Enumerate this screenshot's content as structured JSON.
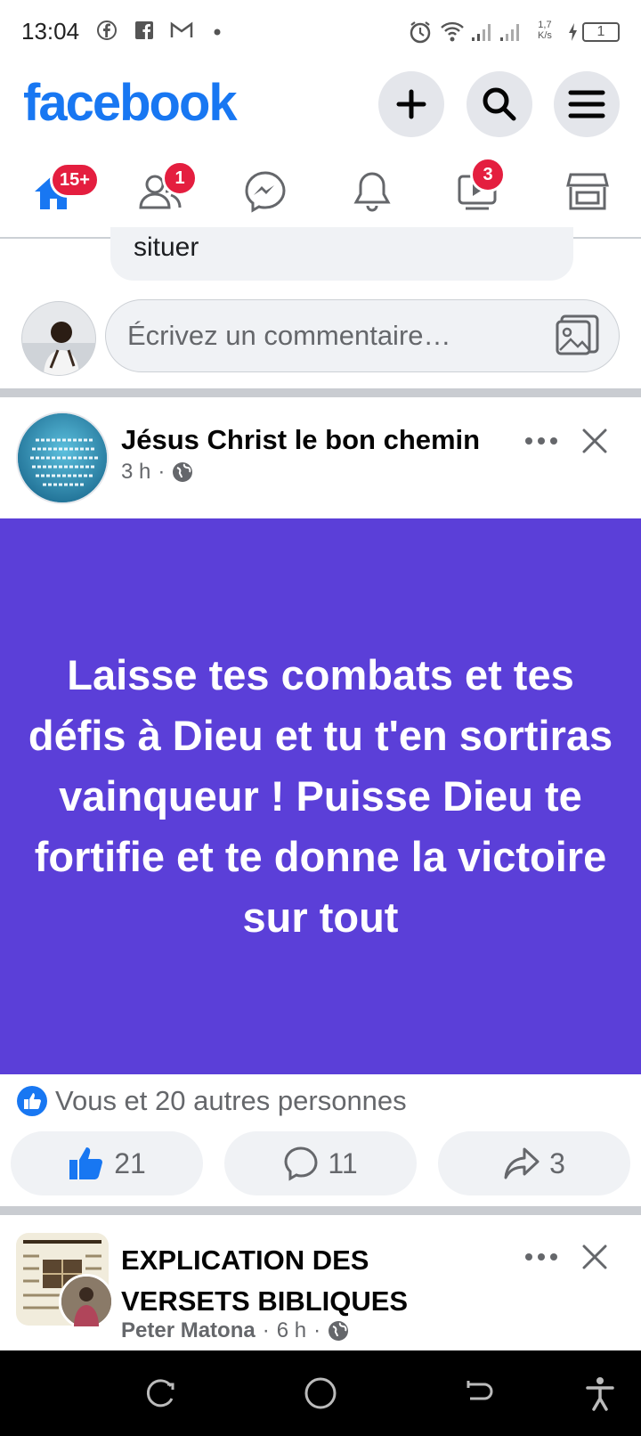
{
  "status_bar": {
    "time": "13:04",
    "network_speed_top": "1,7",
    "network_speed_bottom": "K/s",
    "battery": "1"
  },
  "header": {
    "brand": "facebook",
    "icons": [
      "plus-icon",
      "search-icon",
      "menu-icon"
    ]
  },
  "nav": {
    "home_badge": "15+",
    "friends_badge": "1",
    "video_badge": "3",
    "icons": [
      "home-icon",
      "friends-icon",
      "messenger-icon",
      "bell-icon",
      "video-icon",
      "marketplace-icon"
    ]
  },
  "previous_comment": {
    "text_fragment": "situer"
  },
  "comment_box": {
    "placeholder": "Écrivez un commentaire…"
  },
  "post": {
    "author": "Jésus Christ le bon chemin",
    "time": "3 h",
    "body": "Laisse tes combats et tes défis à Dieu et tu t'en sortiras vainqueur ! Puisse Dieu te fortifie et te donne la victoire sur tout",
    "background_color": "#5b3fd8",
    "reactions_text": "Vous et 20 autres personnes",
    "like_count": "21",
    "comment_count": "11",
    "share_count": "3"
  },
  "post2": {
    "title": "EXPLICATION DES VERSETS BIBLIQUES",
    "author": "Peter Matona",
    "time": "6 h"
  },
  "colors": {
    "brand": "#1877f2",
    "badge": "#e41e3f",
    "divider": "#c9ccd1"
  }
}
